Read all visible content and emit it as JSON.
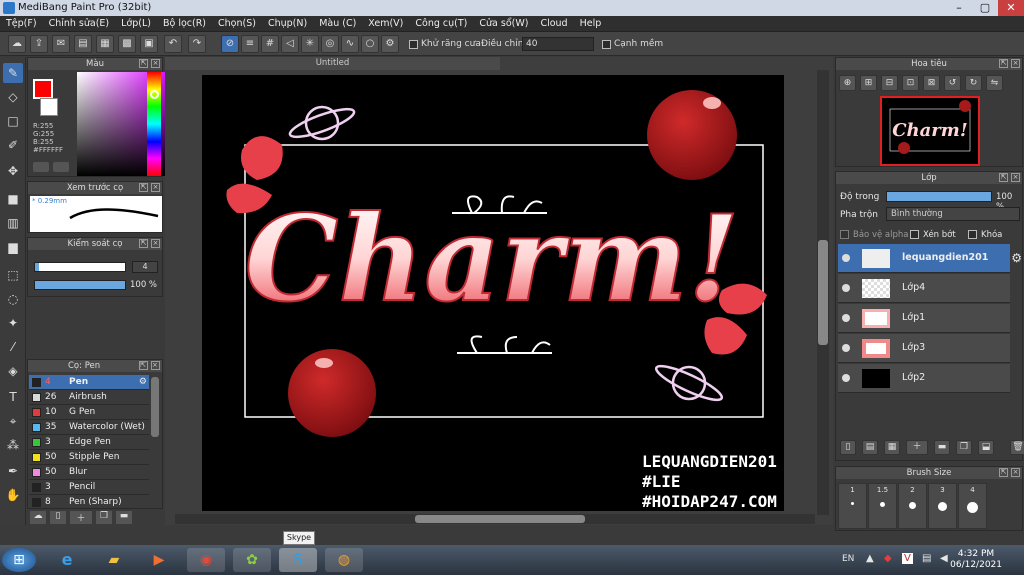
{
  "window": {
    "title": "MediBang Paint Pro (32bit)",
    "min": "–",
    "max": "▢",
    "close": "✕"
  },
  "menu": [
    "Tệp(F)",
    "Chỉnh sửa(E)",
    "Lớp(L)",
    "Bộ lọc(R)",
    "Chọn(S)",
    "Chụp(N)",
    "Màu (C)",
    "Xem(V)",
    "Công cụ(T)",
    "Cửa sổ(W)",
    "Cloud",
    "Help"
  ],
  "toolbar": {
    "antialias_label": "Khử răng cưa",
    "adjust_label": "Điều chỉnh",
    "adjust_value": "40",
    "snap_label": "Cạnh mềm"
  },
  "color_panel": {
    "title": "Màu",
    "rgb": "R:255\nG:255\nB:255\n#FFFFFF",
    "fg_color": "#ff0000",
    "bg_color": "#ffffff"
  },
  "preview_panel": {
    "title": "Xem trước cọ",
    "size": "* 0.29mm"
  },
  "control_panel": {
    "title": "Kiểm soát cọ",
    "size_value": "4",
    "opacity_value": "100 %"
  },
  "brush_panel": {
    "title": "Cọ: Pen",
    "items": [
      {
        "size": "4",
        "name": "Pen",
        "color": "#222222"
      },
      {
        "size": "26",
        "name": "Airbrush",
        "color": "#d8d8d8"
      },
      {
        "size": "10",
        "name": "G Pen",
        "color": "#e23b3b"
      },
      {
        "size": "35",
        "name": "Watercolor (Wet)",
        "color": "#5ab8f0"
      },
      {
        "size": "3",
        "name": "Edge Pen",
        "color": "#3cc23c"
      },
      {
        "size": "50",
        "name": "Stipple Pen",
        "color": "#f0e020"
      },
      {
        "size": "50",
        "name": "Blur",
        "color": "#f08ae0"
      },
      {
        "size": "3",
        "name": "Pencil",
        "color": "#222222"
      },
      {
        "size": "8",
        "name": "Pen (Sharp)",
        "color": "#222222"
      }
    ]
  },
  "canvas": {
    "tab_title": "Untitled",
    "artwork_title": "Charm!",
    "watermark": [
      "LEQUANGDIEN201",
      "#LIE",
      "#HOIDAP247.COM"
    ]
  },
  "navigator": {
    "title": "Hoa tiêu"
  },
  "layer_panel": {
    "title": "Lớp",
    "opacity_label": "Độ trong",
    "opacity_value": "100 %",
    "blend_label": "Pha trộn",
    "blend_value": "Bình thường",
    "protect_alpha": "Bảo vệ alpha",
    "clip_label": "Xén bớt",
    "lock_label": "Khóa",
    "layers": [
      {
        "name": "lequangdien201"
      },
      {
        "name": "Lớp4"
      },
      {
        "name": "Lớp1"
      },
      {
        "name": "Lớp3"
      },
      {
        "name": "Lớp2"
      }
    ]
  },
  "brush_size_panel": {
    "title": "Brush Size",
    "sizes": [
      "1",
      "1.5",
      "2",
      "3",
      "4"
    ]
  },
  "taskbar": {
    "tooltip": "Skype",
    "lang": "EN",
    "time": "4:32 PM",
    "date": "06/12/2021"
  }
}
